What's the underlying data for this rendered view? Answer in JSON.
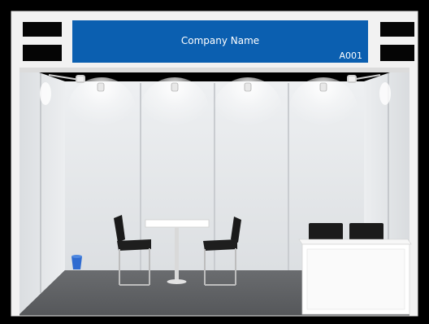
{
  "booth": {
    "company_name": "Company Name",
    "booth_number": "A001"
  },
  "colors": {
    "fascia_blue": "#0b5fb0",
    "frame": "#f2f2f2",
    "panel": "#e6e8ea",
    "floor": "#5d5f62",
    "background": "#000000"
  }
}
